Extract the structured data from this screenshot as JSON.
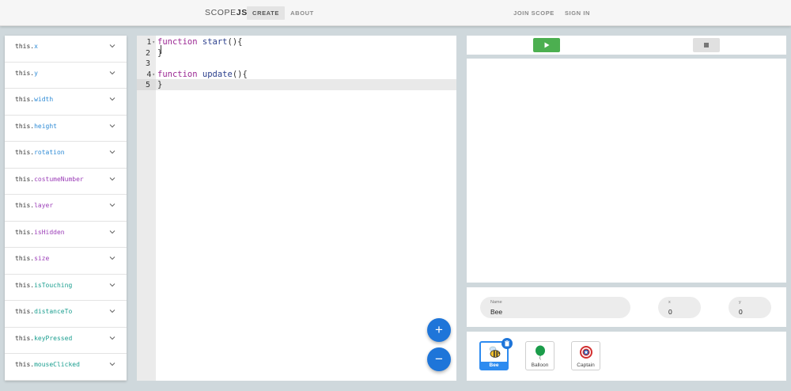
{
  "nav": {
    "brand_light": "SCOPE",
    "brand_bold": "JS",
    "links": [
      {
        "label": "CREATE"
      },
      {
        "label": "ABOUT"
      },
      {
        "label": "JOIN SCOPE"
      },
      {
        "label": "SIGN IN"
      }
    ]
  },
  "properties": [
    {
      "prefix": "this.",
      "name": "x",
      "color": "#2e8bd6"
    },
    {
      "prefix": "this.",
      "name": "y",
      "color": "#2e8bd6"
    },
    {
      "prefix": "this.",
      "name": "width",
      "color": "#2e8bd6"
    },
    {
      "prefix": "this.",
      "name": "height",
      "color": "#2e8bd6"
    },
    {
      "prefix": "this.",
      "name": "rotation",
      "color": "#2e8bd6"
    },
    {
      "prefix": "this.",
      "name": "costumeNumber",
      "color": "#9c3fb8"
    },
    {
      "prefix": "this.",
      "name": "layer",
      "color": "#9c3fb8"
    },
    {
      "prefix": "this.",
      "name": "isHidden",
      "color": "#9c3fb8"
    },
    {
      "prefix": "this.",
      "name": "size",
      "color": "#9c3fb8"
    },
    {
      "prefix": "this.",
      "name": "isTouching",
      "color": "#1a9e8f"
    },
    {
      "prefix": "this.",
      "name": "distanceTo",
      "color": "#1a9e8f"
    },
    {
      "prefix": "this.",
      "name": "keyPressed",
      "color": "#1a9e8f"
    },
    {
      "prefix": "this.",
      "name": "mouseClicked",
      "color": "#1a9e8f"
    }
  ],
  "editor": {
    "line_numbers": [
      "1",
      "2",
      "3",
      "4",
      "5"
    ],
    "fold_marker": "▾",
    "code": [
      {
        "kw": "function",
        "fn": " start",
        "rest": "(){"
      },
      {
        "kw": "",
        "fn": "",
        "rest": "}"
      },
      {
        "kw": "",
        "fn": "",
        "rest": ""
      },
      {
        "kw": "function",
        "fn": " update",
        "rest": "(){"
      },
      {
        "kw": "",
        "fn": "",
        "rest": "}"
      }
    ],
    "zoom_in_label": "+",
    "zoom_out_label": "−"
  },
  "sprite_props": {
    "name_label": "Name",
    "name_value": "Bee",
    "x_label": "x",
    "x_value": "0",
    "y_label": "y",
    "y_value": "0"
  },
  "sprites": [
    {
      "name": "Bee",
      "selected": true
    },
    {
      "name": "Balloon",
      "selected": false
    },
    {
      "name": "Captain",
      "selected": false
    }
  ],
  "colors": {
    "accent": "#1e75d9",
    "play": "#4caf50",
    "selected_sprite": "#2d8bf0"
  }
}
